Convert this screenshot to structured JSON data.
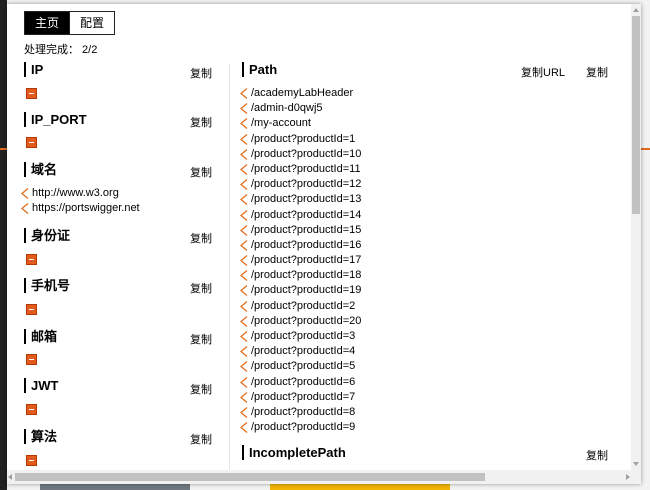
{
  "tabs": [
    {
      "label": "主页",
      "active": true
    },
    {
      "label": "配置",
      "active": false
    }
  ],
  "progress": "处理完成：  2/2",
  "copy_label": "复制",
  "copy_url_label": "复制URL",
  "left_sections": [
    {
      "title": "IP"
    },
    {
      "title": "IP_PORT"
    },
    {
      "title": "域名",
      "items": [
        "http://www.w3.org",
        "https://portswigger.net"
      ]
    },
    {
      "title": "身份证"
    },
    {
      "title": "手机号"
    },
    {
      "title": "邮箱"
    },
    {
      "title": "JWT"
    },
    {
      "title": "算法"
    }
  ],
  "path_section": {
    "title": "Path",
    "items": [
      "/academyLabHeader",
      "/admin-d0qwj5",
      "/my-account",
      "/product?productId=1",
      "/product?productId=10",
      "/product?productId=11",
      "/product?productId=12",
      "/product?productId=13",
      "/product?productId=14",
      "/product?productId=15",
      "/product?productId=16",
      "/product?productId=17",
      "/product?productId=18",
      "/product?productId=19",
      "/product?productId=2",
      "/product?productId=20",
      "/product?productId=3",
      "/product?productId=4",
      "/product?productId=5",
      "/product?productId=6",
      "/product?productId=7",
      "/product?productId=8",
      "/product?productId=9"
    ]
  },
  "incomplete_section": {
    "title": "IncompletePath"
  },
  "colors": {
    "accent": "#e25a1c",
    "chevron": "#e07020",
    "active_tab": "#000000"
  },
  "icons": {
    "empty": "empty-result-icon",
    "item": "chevron-left-icon"
  }
}
